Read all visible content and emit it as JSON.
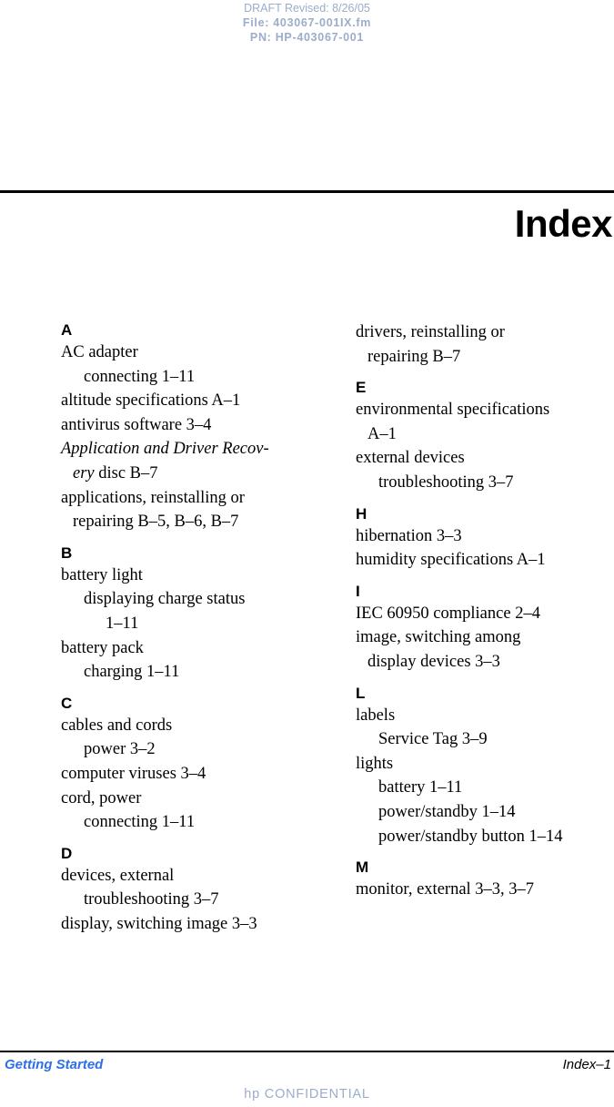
{
  "draft_header": {
    "revision_line": "DRAFT Revised: 8/26/05",
    "file_line": "File: 403067-001IX.fm",
    "pn_line": "PN: HP-403067-001",
    "color": "#9badc9"
  },
  "title": {
    "text": "Index"
  },
  "index": {
    "left_column": [
      {
        "type": "letter",
        "text": "A"
      },
      {
        "type": "entry",
        "level": 0,
        "text": "AC adapter"
      },
      {
        "type": "entry",
        "level": 1,
        "text": "connecting 1–11"
      },
      {
        "type": "entry",
        "level": 0,
        "text": "altitude specifications A–1"
      },
      {
        "type": "entry",
        "level": 0,
        "text": "antivirus software 3–4"
      },
      {
        "type": "entry",
        "level": 0,
        "italic": true,
        "text": "Application and Driver Recov-"
      },
      {
        "type": "entry",
        "level": "cont",
        "italic_prefix": "ery",
        "text": "ery disc B–7"
      },
      {
        "type": "entry",
        "level": 0,
        "text": "applications, reinstalling or"
      },
      {
        "type": "entry",
        "level": "cont",
        "text": "repairing B–5, B–6, B–7"
      },
      {
        "type": "letter",
        "text": "B"
      },
      {
        "type": "entry",
        "level": 0,
        "text": "battery light"
      },
      {
        "type": "entry",
        "level": 1,
        "text": "displaying charge status"
      },
      {
        "type": "entry",
        "level": 2,
        "text": "1–11"
      },
      {
        "type": "entry",
        "level": 0,
        "text": "battery pack"
      },
      {
        "type": "entry",
        "level": 1,
        "text": "charging 1–11"
      },
      {
        "type": "letter",
        "text": "C"
      },
      {
        "type": "entry",
        "level": 0,
        "text": "cables and cords"
      },
      {
        "type": "entry",
        "level": 1,
        "text": "power 3–2"
      },
      {
        "type": "entry",
        "level": 0,
        "text": "computer viruses 3–4"
      },
      {
        "type": "entry",
        "level": 0,
        "text": "cord, power"
      },
      {
        "type": "entry",
        "level": 1,
        "text": "connecting 1–11"
      },
      {
        "type": "letter",
        "text": "D"
      },
      {
        "type": "entry",
        "level": 0,
        "text": "devices, external"
      },
      {
        "type": "entry",
        "level": 1,
        "text": "troubleshooting 3–7"
      },
      {
        "type": "entry",
        "level": 0,
        "text": "display, switching image 3–3"
      }
    ],
    "right_column": [
      {
        "type": "entry",
        "level": 0,
        "text": "drivers, reinstalling or"
      },
      {
        "type": "entry",
        "level": "cont",
        "text": "repairing B–7"
      },
      {
        "type": "letter",
        "text": "E"
      },
      {
        "type": "entry",
        "level": 0,
        "text": "environmental specifications"
      },
      {
        "type": "entry",
        "level": "cont",
        "text": "A–1"
      },
      {
        "type": "entry",
        "level": 0,
        "text": "external devices"
      },
      {
        "type": "entry",
        "level": 1,
        "text": "troubleshooting 3–7"
      },
      {
        "type": "letter",
        "text": "H"
      },
      {
        "type": "entry",
        "level": 0,
        "text": "hibernation 3–3"
      },
      {
        "type": "entry",
        "level": 0,
        "text": "humidity specifications A–1"
      },
      {
        "type": "letter",
        "text": "I"
      },
      {
        "type": "entry",
        "level": 0,
        "text": "IEC 60950 compliance 2–4"
      },
      {
        "type": "entry",
        "level": 0,
        "text": "image, switching among"
      },
      {
        "type": "entry",
        "level": "cont",
        "text": "display devices 3–3"
      },
      {
        "type": "letter",
        "text": "L"
      },
      {
        "type": "entry",
        "level": 0,
        "text": "labels"
      },
      {
        "type": "entry",
        "level": 1,
        "text": "Service Tag 3–9"
      },
      {
        "type": "entry",
        "level": 0,
        "text": "lights"
      },
      {
        "type": "entry",
        "level": 1,
        "text": "battery 1–11"
      },
      {
        "type": "entry",
        "level": 1,
        "text": "power/standby 1–14"
      },
      {
        "type": "entry",
        "level": 1,
        "text": "power/standby button 1–14"
      },
      {
        "type": "letter",
        "text": "M"
      },
      {
        "type": "entry",
        "level": 0,
        "text": "monitor, external 3–3, 3–7"
      }
    ]
  },
  "footer": {
    "book_title": "Getting Started",
    "page_number": "Index–1",
    "confidential": "hp CONFIDENTIAL",
    "book_title_color": "#2e6fe8",
    "confidential_color": "#9badc9"
  }
}
